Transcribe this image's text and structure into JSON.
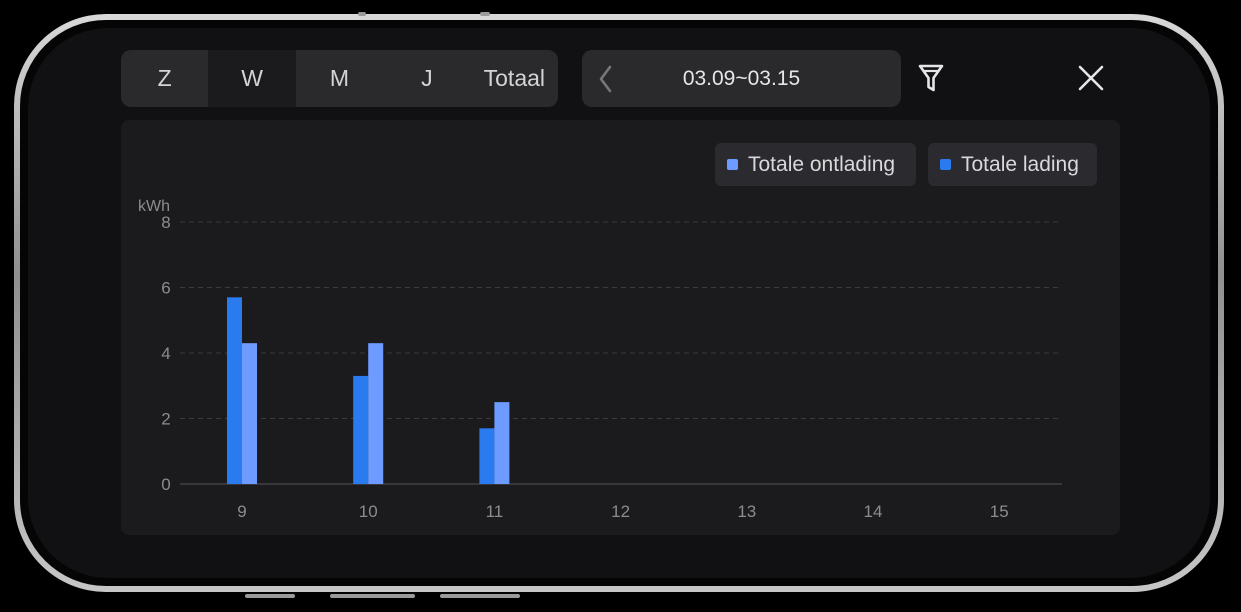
{
  "period_tabs": [
    {
      "label": "Z"
    },
    {
      "label": "W"
    },
    {
      "label": "M"
    },
    {
      "label": "J"
    },
    {
      "label": "Totaal"
    }
  ],
  "active_tab": "W",
  "date_range": {
    "label": "03.09~03.15"
  },
  "icons": {
    "prev": "chevron-left-icon",
    "filter": "filter-icon",
    "close": "close-icon"
  },
  "legend": [
    {
      "label": "Totale ontlading",
      "color": "#6e9bff"
    },
    {
      "label": "Totale lading",
      "color": "#2b7bf0"
    }
  ],
  "chart_data": {
    "type": "bar",
    "y_unit": "kWh",
    "categories": [
      "9",
      "10",
      "11",
      "12",
      "13",
      "14",
      "15"
    ],
    "series": [
      {
        "name": "Totale lading",
        "color": "#2b7bf0",
        "values": [
          5.7,
          3.3,
          1.7,
          0,
          0,
          0,
          0
        ]
      },
      {
        "name": "Totale ontlading",
        "color": "#6e9bff",
        "values": [
          4.3,
          4.3,
          2.5,
          0,
          0,
          0,
          0
        ]
      }
    ],
    "ylim": [
      0,
      8
    ],
    "yticks": [
      0,
      2,
      4,
      6,
      8
    ],
    "grid": true,
    "legend_position": "top-right"
  }
}
